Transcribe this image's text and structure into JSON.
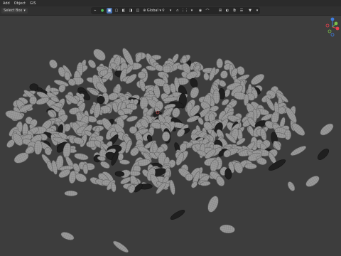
{
  "menu": {
    "items": [
      {
        "label": "Add"
      },
      {
        "label": "Object"
      },
      {
        "label": "GIS"
      }
    ]
  },
  "toolbar": {
    "select_box_label": "Select Box",
    "orientation_label": "Global",
    "orientation_icon": "globe-icon",
    "snap_icon": "magnet-icon",
    "proportional_icon": "circle-dot-icon"
  },
  "gizmo": {
    "x_color": "#e8404e",
    "y_color": "#7cc04a",
    "z_color": "#3f7de0",
    "neg_y_color": "#7cc04a"
  },
  "viewport": {
    "background": "#3d3d3d",
    "seed_fill": "#9a9a9a",
    "seed_mesh": "#7b7b7b",
    "dark_seed_fill": "#1f1f1f"
  }
}
